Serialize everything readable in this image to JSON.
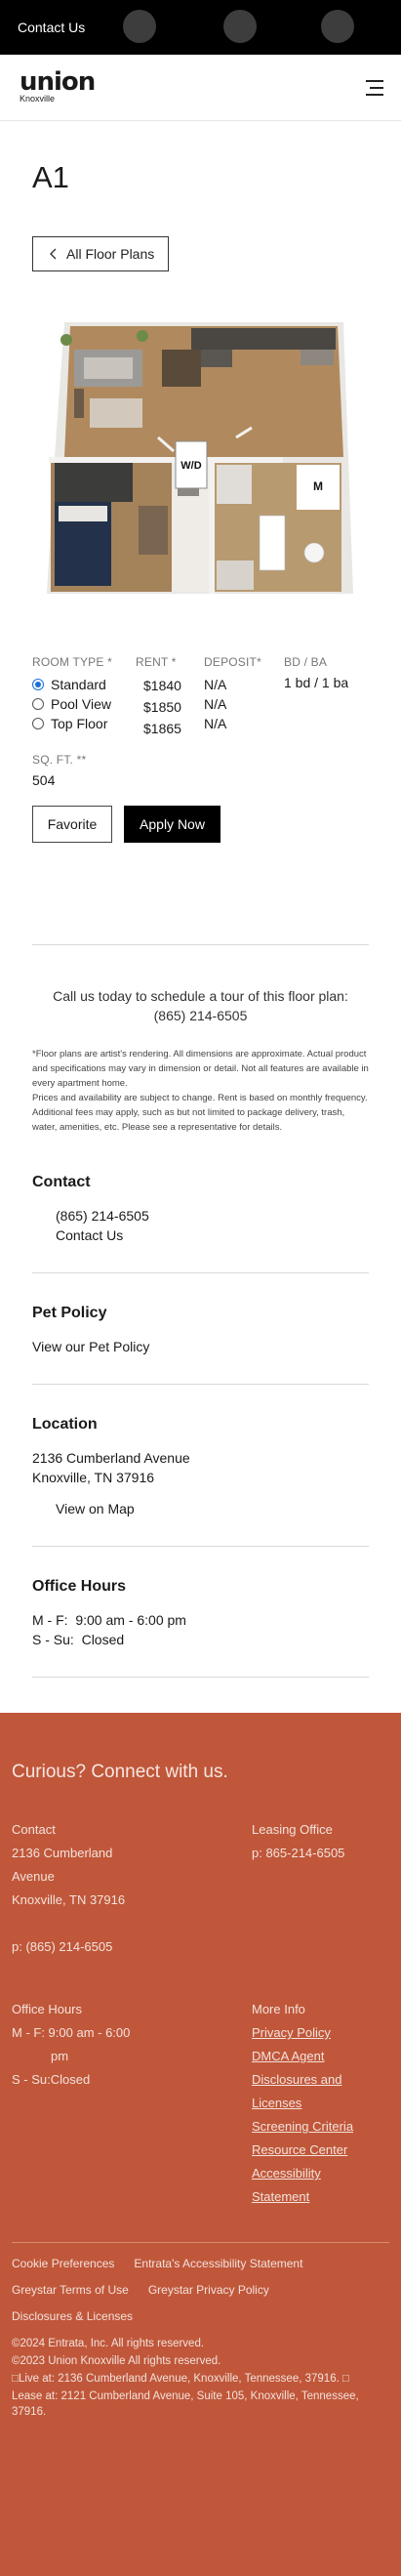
{
  "topbar": {
    "contact_label": "Contact Us"
  },
  "header": {
    "logo_text": "union",
    "logo_sub": "Knoxville"
  },
  "plan": {
    "title": "A1",
    "back_label": "All Floor Plans",
    "floorplan_labels": {
      "washer_dryer": "W/D",
      "master": "M"
    }
  },
  "details": {
    "room_type_label": "ROOM TYPE *",
    "rent_label": "RENT *",
    "deposit_label": "DEPOSIT*",
    "bdba_label": "BD / BA",
    "room_types": [
      {
        "label": "Standard",
        "rent": "$1840",
        "deposit": "N/A",
        "selected": true
      },
      {
        "label": "Pool View",
        "rent": "$1850",
        "deposit": "N/A",
        "selected": false
      },
      {
        "label": "Top Floor",
        "rent": "$1865",
        "deposit": "N/A",
        "selected": false
      }
    ],
    "bdba_value": "1 bd / 1 ba",
    "sqft_label": "SQ. FT. **",
    "sqft_value": "504",
    "favorite_label": "Favorite",
    "apply_label": "Apply Now"
  },
  "call": {
    "text": "Call us today to schedule a tour of this floor plan:",
    "phone": "(865) 214-6505"
  },
  "disclaimer": {
    "p1": "*Floor plans are artist's rendering. All dimensions are approximate. Actual product and specifications may vary in dimension or detail. Not all features are available in every apartment home.",
    "p2": "Prices and availability are subject to change. Rent is based on monthly frequency. Additional fees may apply, such as but not limited to package delivery, trash, water, amenities, etc. Please see a representative for details."
  },
  "contact": {
    "heading": "Contact",
    "phone": "(865) 214-6505",
    "link": "Contact Us"
  },
  "pet": {
    "heading": "Pet Policy",
    "link": "View our Pet Policy"
  },
  "location": {
    "heading": "Location",
    "line1": "2136 Cumberland Avenue",
    "line2": "Knoxville, TN 37916",
    "map_link": "View on Map"
  },
  "hours": {
    "heading": "Office Hours",
    "row1_label": "M - F:",
    "row1_value": "9:00 am - 6:00 pm",
    "row2_label": "S - Su:",
    "row2_value": "Closed"
  },
  "footer": {
    "heading": "Curious? Connect with us.",
    "contact_label": "Contact",
    "address_line1": "2136 Cumberland",
    "address_line2": "Avenue",
    "address_line3": "Knoxville, TN 37916",
    "phone": "p: (865) 214-6505",
    "leasing_label": "Leasing Office",
    "leasing_phone": "p: 865-214-6505",
    "hours_label": "Office Hours",
    "hours_mf": "M - F: 9:00 am - 6:00",
    "hours_mf_cont": "pm",
    "hours_ss": "S - Su:Closed",
    "more_label": "More Info",
    "more_links": [
      "Privacy Policy",
      "DMCA Agent",
      "Disclosures and",
      "Licenses",
      "Screening Criteria",
      "Resource Center",
      "Accessibility",
      "Statement"
    ],
    "bottom_links": [
      "Cookie Preferences",
      "Entrata's Accessibility Statement",
      "Greystar Terms of Use",
      "Greystar Privacy Policy",
      "Disclosures & Licenses"
    ],
    "copyright1": "©2024 Entrata, Inc. All rights reserved.",
    "copyright2": "©2023 Union Knoxville All rights reserved.",
    "copyright3": "□Live at: 2136 Cumberland Avenue, Knoxville, Tennessee, 37916. □",
    "copyright4": "Lease at: 2121 Cumberland Avenue, Suite 105, Knoxville, Tennessee, 37916."
  }
}
